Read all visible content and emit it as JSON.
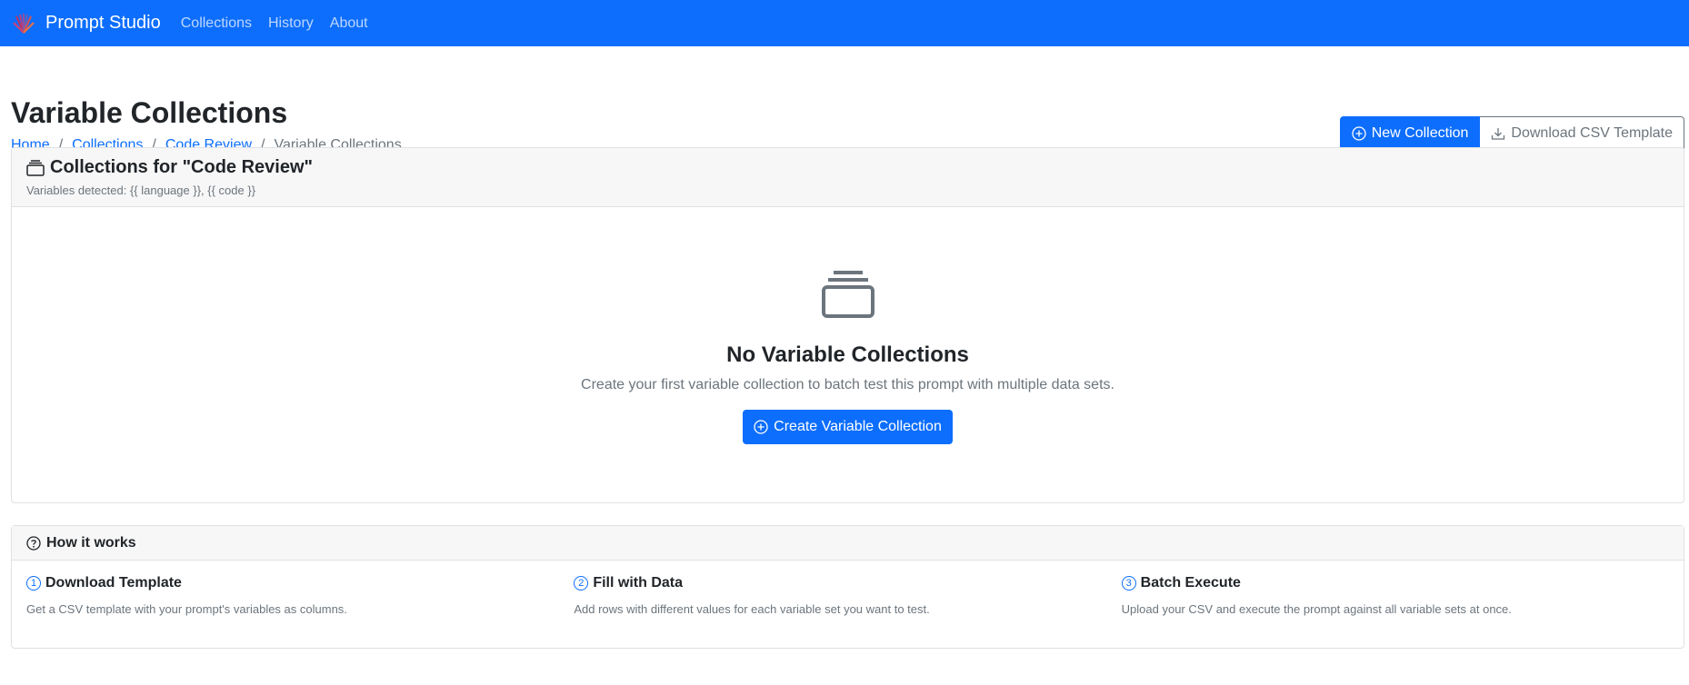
{
  "navbar": {
    "brand": "Prompt Studio",
    "links": [
      "Collections",
      "History",
      "About"
    ]
  },
  "header": {
    "title": "Variable Collections",
    "breadcrumb": [
      "Home",
      "Collections",
      "Code Review",
      "Variable Collections"
    ],
    "new_collection_label": "New Collection",
    "download_csv_label": "Download CSV Template"
  },
  "collections_card": {
    "title": "Collections for \"Code Review\"",
    "variables_text": "Variables detected: {{ language }}, {{ code }}",
    "empty_title": "No Variable Collections",
    "empty_desc": "Create your first variable collection to batch test this prompt with multiple data sets.",
    "create_label": "Create Variable Collection"
  },
  "how_it_works": {
    "title": "How it works",
    "steps": [
      {
        "num": "1",
        "title": "Download Template",
        "desc": "Get a CSV template with your prompt's variables as columns."
      },
      {
        "num": "2",
        "title": "Fill with Data",
        "desc": "Add rows with different values for each variable set you want to test."
      },
      {
        "num": "3",
        "title": "Batch Execute",
        "desc": "Upload your CSV and execute the prompt against all variable sets at once."
      }
    ]
  },
  "colors": {
    "primary": "#0d6efd",
    "muted": "#6c757d"
  }
}
